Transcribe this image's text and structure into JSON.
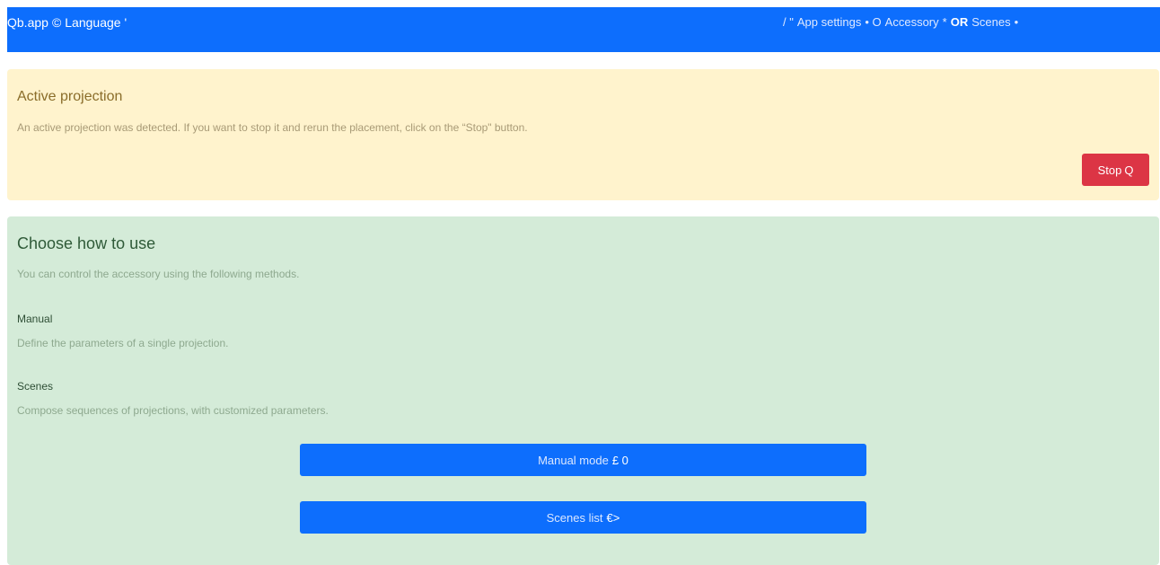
{
  "navbar": {
    "brand": "Qb.app",
    "brand_symbol": "©",
    "language_label": "Language '",
    "links_prefix": "/ \"",
    "links": [
      {
        "label": "App settings",
        "separator": "• O"
      },
      {
        "label": "Accessory",
        "separator": "*"
      },
      {
        "label": "OR",
        "separator": ""
      },
      {
        "label": "Scenes",
        "separator": "•"
      }
    ]
  },
  "active_projection": {
    "title": "Active projection",
    "description": "An active projection was detected. If you want to stop it and rerun the placement, click on the “Stop\" button.",
    "stop_label": "Stop",
    "stop_glyph": "Q"
  },
  "usage": {
    "title": "Choose how to use",
    "intro": "You can control the accessory using the following methods.",
    "methods": [
      {
        "title": "Manual",
        "description": "Define the parameters of a single projection."
      },
      {
        "title": "Scenes",
        "description": "Compose sequences of projections, with customized parameters."
      }
    ],
    "manual_button": {
      "label": "Manual mode",
      "glyph": "£ 0"
    },
    "scenes_button": {
      "label": "Scenes list",
      "glyph": "€>"
    }
  },
  "colors": {
    "primary": "#0d6efd",
    "danger": "#dc3545",
    "warning_bg": "#fff3cd",
    "success_bg": "#d4ebd8"
  }
}
